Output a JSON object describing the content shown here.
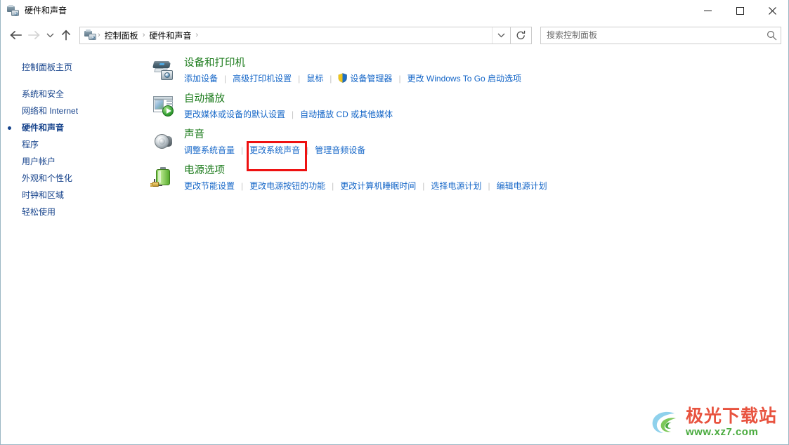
{
  "window": {
    "title": "硬件和声音",
    "title_icon": "devices-printers-icon",
    "controls": {
      "minimize": "最小化",
      "maximize": "最大化",
      "close": "关闭"
    }
  },
  "toolbar": {
    "back": "后退",
    "forward": "前进",
    "recent": "最近浏览的位置",
    "up": "向上",
    "refresh": "刷新",
    "dropdown": "展开"
  },
  "breadcrumb": {
    "icon": "control-panel-icon",
    "items": [
      "控制面板",
      "硬件和声音"
    ],
    "separator": "›"
  },
  "search": {
    "placeholder": "搜索控制面板",
    "value": "",
    "icon": "search-icon"
  },
  "sidebar": {
    "home": "控制面板主页",
    "items": [
      {
        "label": "系统和安全",
        "current": false
      },
      {
        "label": "网络和 Internet",
        "current": false
      },
      {
        "label": "硬件和声音",
        "current": true
      },
      {
        "label": "程序",
        "current": false
      },
      {
        "label": "用户帐户",
        "current": false
      },
      {
        "label": "外观和个性化",
        "current": false
      },
      {
        "label": "时钟和区域",
        "current": false
      },
      {
        "label": "轻松使用",
        "current": false
      }
    ]
  },
  "categories": [
    {
      "icon": "printer-camera-icon",
      "title": "设备和打印机",
      "links": [
        {
          "label": "添加设备",
          "shield": false
        },
        {
          "label": "高级打印机设置",
          "shield": false
        },
        {
          "label": "鼠标",
          "shield": false
        },
        {
          "label": "设备管理器",
          "shield": true
        },
        {
          "label": "更改 Windows To Go 启动选项",
          "shield": false
        }
      ]
    },
    {
      "icon": "autoplay-icon",
      "title": "自动播放",
      "links": [
        {
          "label": "更改媒体或设备的默认设置",
          "shield": false
        },
        {
          "label": "自动播放 CD 或其他媒体",
          "shield": false
        }
      ]
    },
    {
      "icon": "speaker-icon",
      "title": "声音",
      "links": [
        {
          "label": "调整系统音量",
          "shield": false
        },
        {
          "label": "更改系统声音",
          "shield": false
        },
        {
          "label": "管理音频设备",
          "shield": false
        }
      ]
    },
    {
      "icon": "battery-plug-icon",
      "title": "电源选项",
      "links": [
        {
          "label": "更改节能设置",
          "shield": false
        },
        {
          "label": "更改电源按钮的功能",
          "shield": false
        },
        {
          "label": "更改计算机睡眠时间",
          "shield": false
        },
        {
          "label": "选择电源计划",
          "shield": false
        },
        {
          "label": "编辑电源计划",
          "shield": false
        }
      ]
    }
  ],
  "highlight": {
    "target": "更改系统声音",
    "color": "#ee1111"
  },
  "watermark": {
    "title": "极光下载站",
    "url": "www.xz7.com",
    "title_color": "#e8533f",
    "url_color": "#4aab3f"
  },
  "colors": {
    "category_title": "#1a7a1a",
    "link": "#1667c8",
    "sidebar_link": "#15428b",
    "window_border": "#9bb7c4"
  }
}
